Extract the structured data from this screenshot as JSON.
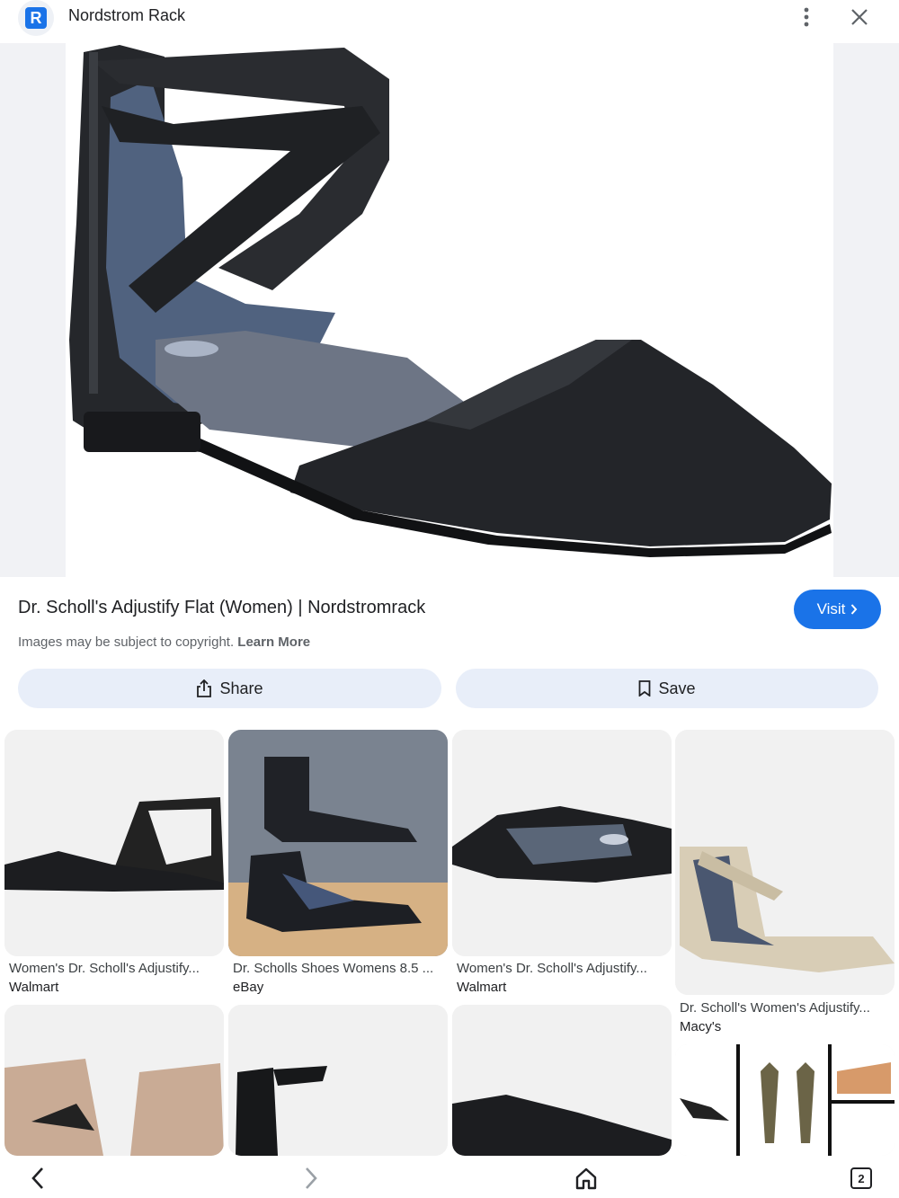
{
  "header": {
    "site_name": "Nordstrom Rack",
    "logo_letter": "R",
    "more_icon": "more-vert-icon",
    "close_icon": "close-icon"
  },
  "result": {
    "title": "Dr. Scholl's Adjustify Flat (Women) | Nordstromrack",
    "visit_label": "Visit",
    "copyright_text": "Images may be subject to copyright.",
    "learn_more_label": "Learn More",
    "share_label": "Share",
    "save_label": "Save"
  },
  "related": [
    {
      "title": "Women's Dr. Scholl's Adjustify...",
      "source": "Walmart"
    },
    {
      "title": "Dr. Scholls Shoes Womens 8.5 ...",
      "source": "eBay"
    },
    {
      "title": "Women's Dr. Scholl's Adjustify...",
      "source": "Walmart"
    },
    {
      "title": "Dr. Scholl's Women's Adjustify...",
      "source": "Macy's"
    }
  ],
  "bottom_nav": {
    "tab_count": "2"
  },
  "colors": {
    "accent": "#1a73e8",
    "pill_bg": "#e8eef9",
    "shoe_black": "#1f2124",
    "insole_blue": "#5c6f8f"
  }
}
